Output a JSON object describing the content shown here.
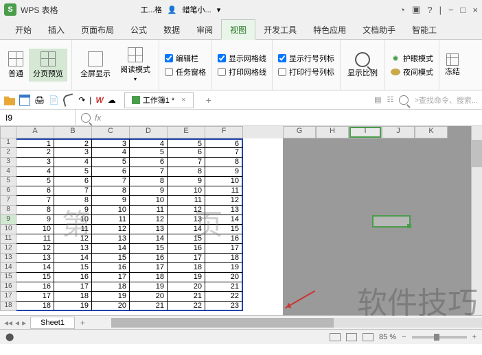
{
  "title": {
    "app": "WPS 表格",
    "logo": "S"
  },
  "titlebar_mid": {
    "doc1": "工...格",
    "doc2": "蜡笔小..."
  },
  "win_controls": {
    "min": "−",
    "max": "□",
    "close": "×"
  },
  "tabs": [
    "开始",
    "插入",
    "页面布局",
    "公式",
    "数据",
    "审阅",
    "视图",
    "开发工具",
    "特色应用",
    "文档助手",
    "智能工"
  ],
  "active_tab": 6,
  "ribbon": {
    "views": {
      "normal": "普通",
      "page_preview": "分页预览",
      "fullscreen": "全屏显示",
      "read_mode": "阅读模式"
    },
    "chks1": {
      "formula_bar": "编辑栏",
      "task_pane": "任务窗格"
    },
    "chks2": {
      "gridlines": "显示网格线",
      "print_grid": "打印网格线",
      "headings": "显示行号列标",
      "print_headings": "打印行号列标"
    },
    "zoom": "显示比例",
    "eye_mode": "护眼模式",
    "night_mode": "夜间模式",
    "freeze": "冻结"
  },
  "qat": {
    "doc_name": "工作簿1 *",
    "plus": "+",
    "search_placeholder": ">查找命令、搜索..."
  },
  "namebox": "I9",
  "fx": "fx",
  "cols": [
    "A",
    "B",
    "C",
    "D",
    "E",
    "F"
  ],
  "gray_cols": [
    "G",
    "H",
    "I",
    "J",
    "K"
  ],
  "active_col_idx": 2,
  "rows": [
    {
      "n": 1,
      "v": [
        1,
        2,
        3,
        4,
        5,
        6
      ]
    },
    {
      "n": 2,
      "v": [
        2,
        3,
        4,
        5,
        6,
        7
      ]
    },
    {
      "n": 3,
      "v": [
        3,
        4,
        5,
        6,
        7,
        8
      ]
    },
    {
      "n": 4,
      "v": [
        4,
        5,
        6,
        7,
        8,
        9
      ]
    },
    {
      "n": 5,
      "v": [
        5,
        6,
        7,
        8,
        9,
        10
      ]
    },
    {
      "n": 6,
      "v": [
        6,
        7,
        8,
        9,
        10,
        11
      ]
    },
    {
      "n": 7,
      "v": [
        7,
        8,
        9,
        10,
        11,
        12
      ]
    },
    {
      "n": 8,
      "v": [
        8,
        9,
        10,
        11,
        12,
        13
      ]
    },
    {
      "n": 9,
      "v": [
        9,
        10,
        11,
        12,
        13,
        14
      ]
    },
    {
      "n": 10,
      "v": [
        10,
        11,
        12,
        13,
        14,
        15
      ]
    },
    {
      "n": 11,
      "v": [
        11,
        12,
        13,
        14,
        15,
        16
      ]
    },
    {
      "n": 12,
      "v": [
        12,
        13,
        14,
        15,
        16,
        17
      ]
    },
    {
      "n": 13,
      "v": [
        13,
        14,
        15,
        16,
        17,
        18
      ]
    },
    {
      "n": 14,
      "v": [
        14,
        15,
        16,
        17,
        18,
        19
      ]
    },
    {
      "n": 15,
      "v": [
        15,
        16,
        17,
        18,
        19,
        20
      ]
    },
    {
      "n": 16,
      "v": [
        16,
        17,
        18,
        19,
        20,
        21
      ]
    },
    {
      "n": 17,
      "v": [
        17,
        18,
        19,
        20,
        21,
        22
      ]
    },
    {
      "n": 18,
      "v": [
        18,
        19,
        20,
        21,
        22,
        23
      ]
    }
  ],
  "highlight_row": 9,
  "watermark": "第 页",
  "watermark2": "软件技巧",
  "sheet_tab": "Sheet1",
  "status": {
    "zoom": "85 %",
    "minus": "−",
    "plus": "+"
  }
}
